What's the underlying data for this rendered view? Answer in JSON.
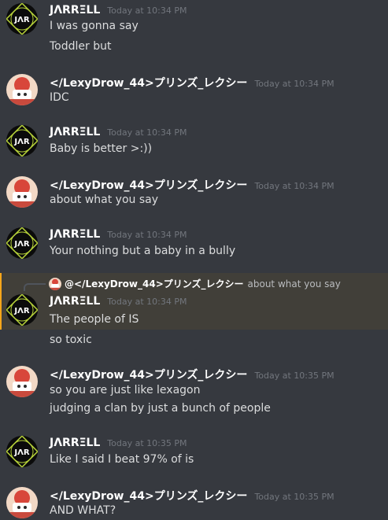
{
  "users": {
    "jarrell": {
      "name": "JΛRRΞLL",
      "avatar_text": "JΛR"
    },
    "lexy": {
      "name": "</LexyDrow_44>プリンズ_レクシー"
    }
  },
  "messages": [
    {
      "author": "JΛRRΞLL",
      "time": "Today at 10:34 PM",
      "lines": [
        "I was gonna say",
        "Toddler but"
      ]
    },
    {
      "author": "</LexyDrow_44>プリンズ_レクシー",
      "time": "Today at 10:34 PM",
      "lines": [
        "IDC"
      ]
    },
    {
      "author": "JΛRRΞLL",
      "time": "Today at 10:34 PM",
      "lines": [
        "Baby is better >:))"
      ]
    },
    {
      "author": "</LexyDrow_44>プリンズ_レクシー",
      "time": "Today at 10:34 PM",
      "lines": [
        "about what you say"
      ]
    },
    {
      "author": "JΛRRΞLL",
      "time": "Today at 10:34 PM",
      "lines": [
        "Your nothing but a baby in a bully"
      ]
    },
    {
      "author": "JΛRRΞLL",
      "time": "Today at 10:34 PM",
      "lines": [
        "The people of IS",
        "so toxic"
      ],
      "reply": {
        "author": "@</LexyDrow_44>プリンズ_レクシー",
        "text": "about what you say"
      }
    },
    {
      "author": "</LexyDrow_44>プリンズ_レクシー",
      "time": "Today at 10:35 PM",
      "lines": [
        "so you are just like lexagon",
        "judging a clan by just a bunch of people"
      ]
    },
    {
      "author": "JΛRRΞLL",
      "time": "Today at 10:35 PM",
      "lines": [
        "Like I said I beat 97% of is"
      ]
    },
    {
      "author": "</LexyDrow_44>プリンズ_レクシー",
      "time": "Today at 10:35 PM",
      "lines": [
        "AND WHAT?"
      ]
    }
  ],
  "colors": {
    "background": "#36393f",
    "mention_highlight": "#413f39",
    "mention_bar": "#faa61a",
    "timestamp": "#72767d"
  }
}
